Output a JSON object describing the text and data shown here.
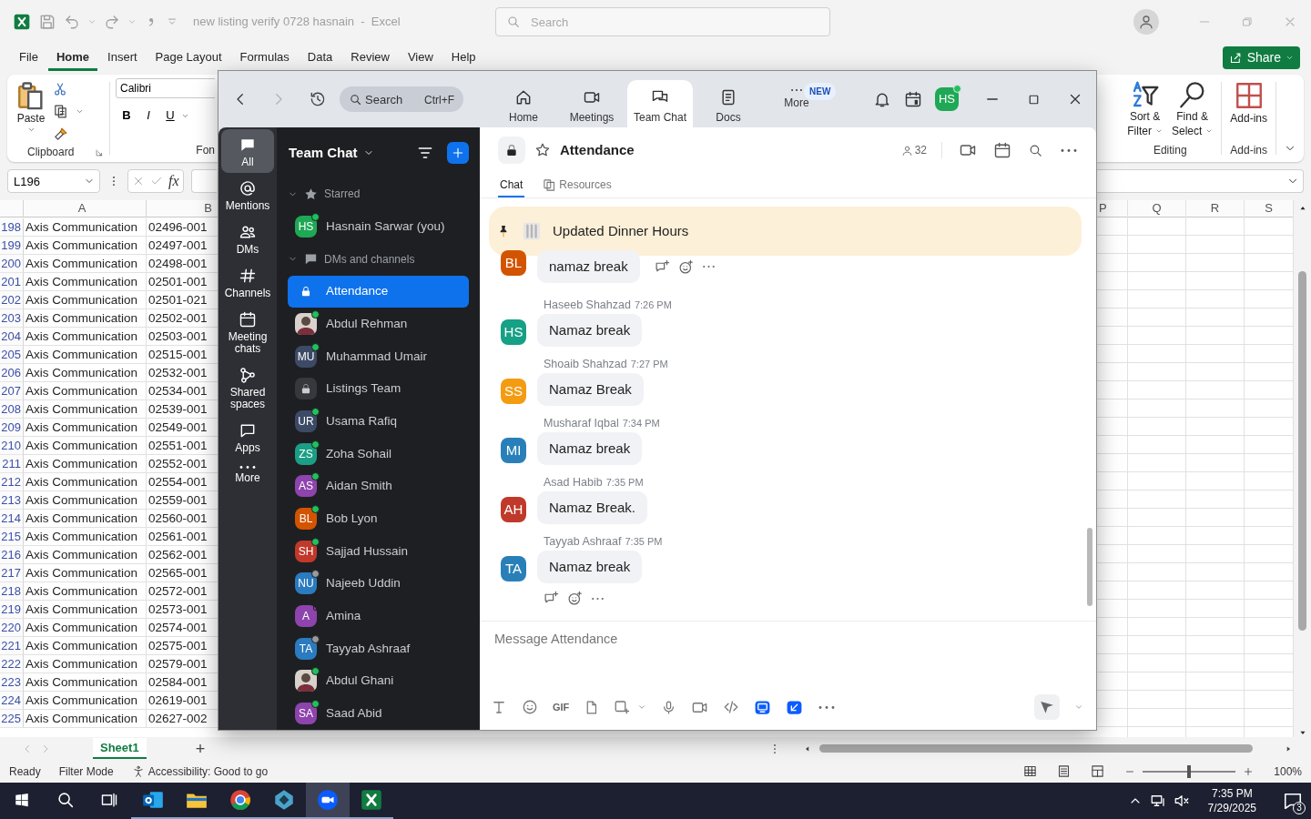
{
  "excel": {
    "title": "new listing verify 0728 hasnain  -  Excel",
    "search": {
      "placeholder": "Search"
    },
    "menu": [
      {
        "label": "File",
        "selected": false
      },
      {
        "label": "Home",
        "selected": true
      },
      {
        "label": "Insert",
        "selected": false
      },
      {
        "label": "Page Layout",
        "selected": false
      },
      {
        "label": "Formulas",
        "selected": false
      },
      {
        "label": "Data",
        "selected": false
      },
      {
        "label": "Review",
        "selected": false
      },
      {
        "label": "View",
        "selected": false
      },
      {
        "label": "Help",
        "selected": false
      }
    ],
    "share": "Share",
    "clipboard": {
      "paste": "Paste",
      "group": "Clipboard"
    },
    "font": {
      "name": "Calibri",
      "buttons": [
        "B",
        "I",
        "U"
      ],
      "group": "Fon"
    },
    "editing": {
      "buttons": [
        {
          "kind": "sort",
          "line1": "Sort &",
          "line2": "Filter"
        },
        {
          "kind": "find",
          "line1": "Find &",
          "line2": "Select"
        }
      ],
      "group": "Editing"
    },
    "addins": {
      "button": "Add-ins",
      "group": "Add-ins"
    },
    "name_box": "L196",
    "fx": "fx",
    "columns_left": [
      "A",
      "B"
    ],
    "columns_right": [
      "P",
      "Q",
      "R",
      "S"
    ],
    "rows": [
      {
        "number": "198",
        "cells": [
          "Axis Communication",
          "02496-001"
        ]
      },
      {
        "number": "199",
        "cells": [
          "Axis Communication",
          "02497-001"
        ]
      },
      {
        "number": "200",
        "cells": [
          "Axis Communication",
          "02498-001"
        ]
      },
      {
        "number": "201",
        "cells": [
          "Axis Communication",
          "02501-001"
        ]
      },
      {
        "number": "202",
        "cells": [
          "Axis Communication",
          "02501-021"
        ]
      },
      {
        "number": "203",
        "cells": [
          "Axis Communication",
          "02502-001"
        ]
      },
      {
        "number": "204",
        "cells": [
          "Axis Communication",
          "02503-001"
        ]
      },
      {
        "number": "205",
        "cells": [
          "Axis Communication",
          "02515-001"
        ]
      },
      {
        "number": "206",
        "cells": [
          "Axis Communication",
          "02532-001"
        ]
      },
      {
        "number": "207",
        "cells": [
          "Axis Communication",
          "02534-001"
        ]
      },
      {
        "number": "208",
        "cells": [
          "Axis Communication",
          "02539-001"
        ]
      },
      {
        "number": "209",
        "cells": [
          "Axis Communication",
          "02549-001"
        ]
      },
      {
        "number": "210",
        "cells": [
          "Axis Communication",
          "02551-001"
        ]
      },
      {
        "number": "211",
        "cells": [
          "Axis Communication",
          "02552-001"
        ]
      },
      {
        "number": "212",
        "cells": [
          "Axis Communication",
          "02554-001"
        ]
      },
      {
        "number": "213",
        "cells": [
          "Axis Communication",
          "02559-001"
        ]
      },
      {
        "number": "214",
        "cells": [
          "Axis Communication",
          "02560-001"
        ]
      },
      {
        "number": "215",
        "cells": [
          "Axis Communication",
          "02561-001"
        ]
      },
      {
        "number": "216",
        "cells": [
          "Axis Communication",
          "02562-001"
        ]
      },
      {
        "number": "217",
        "cells": [
          "Axis Communication",
          "02565-001"
        ]
      },
      {
        "number": "218",
        "cells": [
          "Axis Communication",
          "02572-001"
        ]
      },
      {
        "number": "219",
        "cells": [
          "Axis Communication",
          "02573-001"
        ]
      },
      {
        "number": "220",
        "cells": [
          "Axis Communication",
          "02574-001"
        ]
      },
      {
        "number": "221",
        "cells": [
          "Axis Communication",
          "02575-001"
        ]
      },
      {
        "number": "222",
        "cells": [
          "Axis Communication",
          "02579-001"
        ]
      },
      {
        "number": "223",
        "cells": [
          "Axis Communication",
          "02584-001"
        ]
      },
      {
        "number": "224",
        "cells": [
          "Axis Communication",
          "02619-001"
        ]
      },
      {
        "number": "225",
        "cells": [
          "Axis Communication",
          "02627-002"
        ]
      }
    ],
    "sheets": [
      {
        "label": "Sheet1",
        "selected": true
      }
    ],
    "add_sheet": "+",
    "status": {
      "ready": "Ready",
      "filter": "Filter Mode",
      "accessibility": "Accessibility: Good to go",
      "zoom": "100%",
      "zoom_slider": {
        "level": 0.5
      }
    }
  },
  "zoom": {
    "search": {
      "placeholder": "Search",
      "shortcut": "Ctrl+F"
    },
    "nav": [
      {
        "kind": "home",
        "label": "Home",
        "selected": false
      },
      {
        "kind": "meetings",
        "label": "Meetings",
        "selected": false
      },
      {
        "kind": "chat",
        "label": "Team Chat",
        "selected": true
      },
      {
        "kind": "docs",
        "label": "Docs",
        "selected": false
      },
      {
        "kind": "more",
        "label": "More",
        "selected": false,
        "badge": "NEW"
      }
    ],
    "user": {
      "initials": "HS",
      "color": "#1fa855",
      "presence": {
        "kind": "online"
      }
    },
    "rail": [
      {
        "kind": "all",
        "label": "All",
        "selected": true
      },
      {
        "kind": "mentions",
        "label": "Mentions",
        "selected": false
      },
      {
        "kind": "dms",
        "label": "DMs",
        "selected": false
      },
      {
        "kind": "channels",
        "label": "Channels",
        "selected": false
      },
      {
        "kind": "meetings",
        "label": "Meeting chats",
        "selected": false
      },
      {
        "kind": "shared",
        "label": "Shared spaces",
        "selected": false
      },
      {
        "kind": "apps",
        "label": "Apps",
        "selected": false
      },
      {
        "kind": "more",
        "label": "More",
        "selected": false
      }
    ],
    "list_title": "Team Chat",
    "sections": [
      {
        "kind": "starred",
        "label": "Starred",
        "expanded": true,
        "items": [
          {
            "kind": "initials",
            "name": "Hasnain Sarwar (you)",
            "initials": "HS",
            "color": "#1fa855",
            "presence": {
              "kind": "online"
            },
            "selected": false
          }
        ]
      },
      {
        "kind": "dms",
        "label": "DMs and channels",
        "expanded": true,
        "items": [
          {
            "kind": "lock",
            "name": "Attendance",
            "selected": true
          },
          {
            "kind": "photo",
            "name": "Abdul Rehman",
            "presence": {
              "kind": "online"
            },
            "selected": false
          },
          {
            "kind": "initials",
            "name": "Muhammad Umair",
            "initials": "MU",
            "color": "#3d4a66",
            "presence": {
              "kind": "online"
            },
            "selected": false
          },
          {
            "kind": "lock",
            "name": "Listings Team",
            "selected": false
          },
          {
            "kind": "initials",
            "name": "Usama Rafiq",
            "initials": "UR",
            "color": "#3d4a66",
            "presence": {
              "kind": "online"
            },
            "selected": false
          },
          {
            "kind": "initials",
            "name": "Zoha Sohail",
            "initials": "ZS",
            "color": "#1b9e85",
            "presence": {
              "kind": "online"
            },
            "selected": false
          },
          {
            "kind": "initials",
            "name": "Aidan Smith",
            "initials": "AS",
            "color": "#8e44ad",
            "presence": {
              "kind": "online"
            },
            "selected": false
          },
          {
            "kind": "initials",
            "name": "Bob Lyon",
            "initials": "BL",
            "color": "#d35400",
            "presence": {
              "kind": "online"
            },
            "selected": false
          },
          {
            "kind": "initials",
            "name": "Sajjad Hussain",
            "initials": "SH",
            "color": "#c0392b",
            "presence": {
              "kind": "online"
            },
            "selected": false
          },
          {
            "kind": "initials",
            "name": "Najeeb Uddin",
            "initials": "NU",
            "color": "#2a7bbf",
            "presence": {
              "kind": "away"
            },
            "selected": false
          },
          {
            "kind": "initials",
            "name": "Amina",
            "initials": "A",
            "color": "#8e44ad",
            "presence": {
              "kind": "mobile"
            },
            "selected": false
          },
          {
            "kind": "initials",
            "name": "Tayyab Ashraaf",
            "initials": "TA",
            "color": "#2a7bbf",
            "presence": {
              "kind": "away"
            },
            "selected": false
          },
          {
            "kind": "photo",
            "name": "Abdul Ghani",
            "presence": {
              "kind": "online"
            },
            "selected": false
          },
          {
            "kind": "initials",
            "name": "Saad Abid",
            "initials": "SA",
            "color": "#8e44ad",
            "presence": {
              "kind": "online"
            },
            "selected": false
          }
        ]
      }
    ],
    "channel": {
      "title": "Attendance",
      "members": "32",
      "starred": false,
      "tabs": [
        {
          "kind": "chat",
          "label": "Chat",
          "selected": true
        },
        {
          "kind": "resources",
          "label": "Resources",
          "selected": false
        }
      ]
    },
    "pinned": {
      "title": "Updated Dinner Hours"
    },
    "messages": [
      {
        "initials": "BL",
        "color": "#d35400",
        "text": "namaz break",
        "actions": {
          "kind": "inline"
        }
      },
      {
        "sender": "Haseeb Shahzad",
        "time": "7:26 PM",
        "initials": "HS",
        "color": "#16a085",
        "text": "Namaz break"
      },
      {
        "sender": "Shoaib Shahzad",
        "time": "7:27 PM",
        "initials": "SS",
        "color": "#f39c12",
        "text": "Namaz Break"
      },
      {
        "sender": "Musharaf Iqbal",
        "time": "7:34 PM",
        "initials": "MI",
        "color": "#2980b9",
        "text": "Namaz break"
      },
      {
        "sender": "Asad Habib",
        "time": "7:35 PM",
        "initials": "AH",
        "color": "#c0392b",
        "text": "Namaz Break."
      },
      {
        "sender": "Tayyab Ashraaf",
        "time": "7:35 PM",
        "initials": "TA",
        "color": "#2980b9",
        "text": "Namaz break",
        "actions": {
          "kind": "below"
        }
      }
    ],
    "composer": {
      "placeholder": "Message Attendance",
      "gif": "GIF"
    }
  },
  "taskbar": {
    "apps": [
      {
        "kind": "outlook",
        "active": false
      },
      {
        "kind": "folder",
        "active": false
      },
      {
        "kind": "chrome",
        "active": false
      },
      {
        "kind": "diamond",
        "active": false
      },
      {
        "kind": "zoom",
        "active": true
      },
      {
        "kind": "excel",
        "active": false
      }
    ],
    "time": "7:35 PM",
    "date": "7/29/2025",
    "notifications": "3"
  }
}
